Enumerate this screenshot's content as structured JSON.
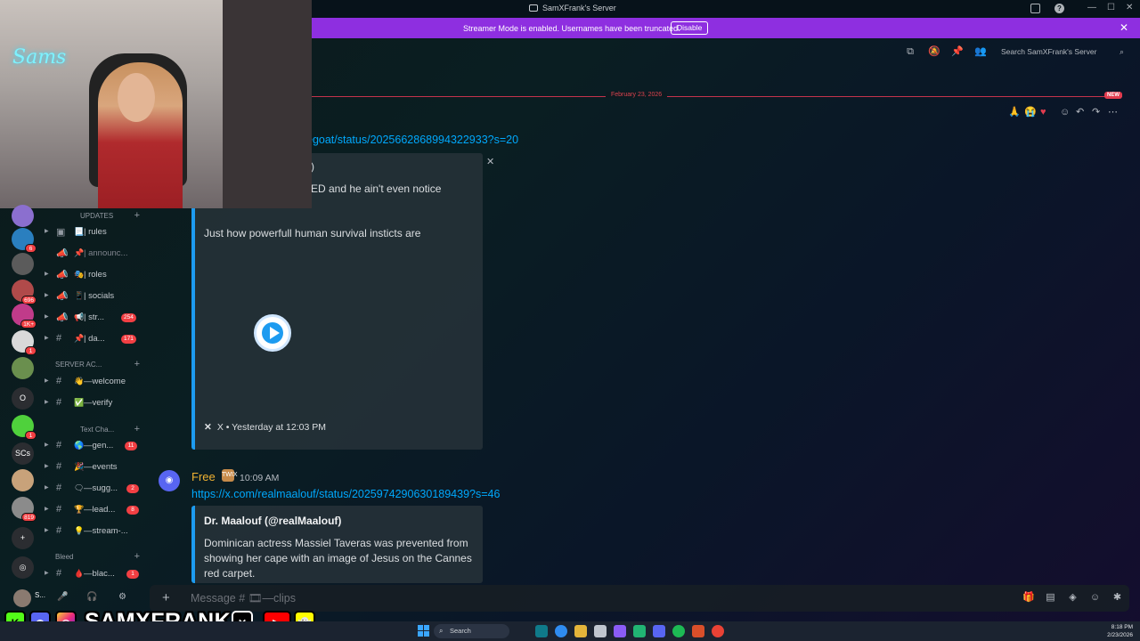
{
  "window": {
    "title": "SamXFrank's Server"
  },
  "banner": {
    "message": "Streamer Mode is enabled. Usernames have been truncated.",
    "disable_label": "Disable"
  },
  "header": {
    "search_placeholder": "Search SamXFrank's Server"
  },
  "divider": {
    "date": "February 23, 2026",
    "new_label": "NEW"
  },
  "message1": {
    "link_fragment": "egoat/status/2025662868994322933?s=20",
    "embed": {
      "text_fragment_1": ")",
      "text_fragment_2": "ED and he ain't even notice",
      "description": "Just how powerfull human survival insticts are",
      "footer_source": "X",
      "footer_time": "X • Yesterday at 12:03 PM"
    }
  },
  "message2": {
    "author": "Free",
    "badge": "TWIX",
    "time": "10:09 AM",
    "link": "https://x.com/realmaalouf/status/2025974290630189439?s=46",
    "embed": {
      "author": "Dr. Maalouf (@realMaalouf)",
      "description": "Dominican actress Massiel Taveras was prevented from showing her cape with an image of Jesus on the Cannes red carpet."
    }
  },
  "channels": {
    "categories": {
      "updates": "UPDATES",
      "server": "SERVER AC...",
      "text": "Text Cha...",
      "bleed": "Bleed"
    },
    "items": [
      {
        "emoji": "📃",
        "name": "| rules",
        "count": ""
      },
      {
        "emoji": "📌",
        "name": "| announc...",
        "count": ""
      },
      {
        "emoji": "🎭",
        "name": "| roles",
        "count": ""
      },
      {
        "emoji": "📱",
        "name": "| socials",
        "count": ""
      },
      {
        "emoji": "📢",
        "name": "| str...",
        "count": "254"
      },
      {
        "emoji": "📌",
        "name": "| da...",
        "count": "171"
      },
      {
        "emoji": "👋",
        "name": "—welcome",
        "count": ""
      },
      {
        "emoji": "✅",
        "name": "—verify",
        "count": ""
      },
      {
        "emoji": "🌎",
        "name": "—gen...",
        "count": "11"
      },
      {
        "emoji": "🎉",
        "name": "—events",
        "count": ""
      },
      {
        "emoji": "🗨",
        "name": "—sugg...",
        "count": "2"
      },
      {
        "emoji": "🏆",
        "name": "—lead...",
        "count": "8"
      },
      {
        "emoji": "💡",
        "name": "—stream-...",
        "count": ""
      },
      {
        "emoji": "🩸",
        "name": "—blac...",
        "count": "1"
      }
    ]
  },
  "servers": [
    {
      "label": "",
      "badge": "",
      "color": "#8b6fcf"
    },
    {
      "label": "",
      "badge": "6",
      "color": "#2a7fbf"
    },
    {
      "label": "",
      "badge": "",
      "color": "#5b5b5b"
    },
    {
      "label": "",
      "badge": "696",
      "color": "#b04a4a"
    },
    {
      "label": "",
      "badge": "1K+",
      "color": "#c03b8a"
    },
    {
      "label": "",
      "badge": "1",
      "color": "#d9d9d9"
    },
    {
      "label": "",
      "badge": "",
      "color": "#6a8f4e"
    },
    {
      "label": "O",
      "badge": "",
      "color": "#2b2d31"
    },
    {
      "label": "",
      "badge": "1",
      "color": "#4fd13c"
    },
    {
      "label": "SCs",
      "badge": "",
      "color": "#2b2d31"
    },
    {
      "label": "",
      "badge": "",
      "color": "#c8a27a"
    },
    {
      "label": "",
      "badge": "819",
      "color": "#8b8b8b"
    },
    {
      "label": "+",
      "badge": "",
      "color": "#2b2d31"
    },
    {
      "label": "◎",
      "badge": "",
      "color": "#2b2d31"
    }
  ],
  "composer": {
    "placeholder": "Message # 🎞—clips"
  },
  "user": {
    "name": "S..."
  },
  "overlay": {
    "handle": "SAMXFRANK"
  },
  "webcam": {
    "neon_sign": "Sams"
  },
  "taskbar": {
    "search": "Search",
    "time": "8:18 PM",
    "date": "2/23/2026"
  }
}
